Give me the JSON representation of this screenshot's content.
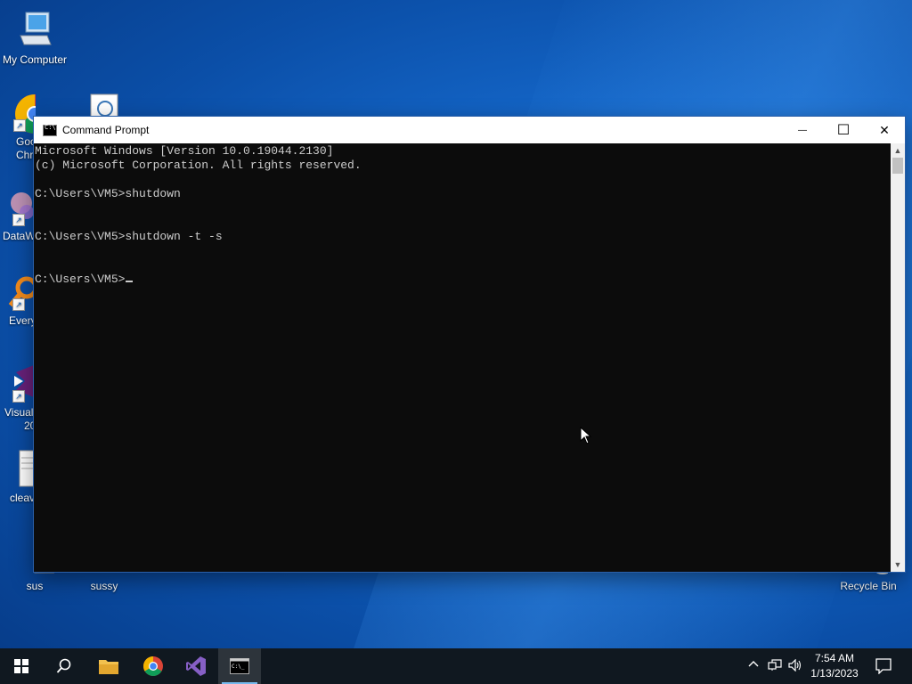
{
  "desktop": {
    "icons": {
      "my_computer": "My Computer",
      "google_chrome_1": "Goo",
      "google_chrome_2": "Chr",
      "datawrapper": "DataW",
      "everything": "Every",
      "visual_studio_1": "Visual",
      "visual_studio_2": "20",
      "cleav": "cleav",
      "sus": "sus",
      "sussy": "sussy",
      "recycle_bin": "Recycle Bin"
    }
  },
  "window": {
    "title": "Command Prompt",
    "minimize": "—",
    "maximize": "☐",
    "close": "✕",
    "console_lines": [
      "Microsoft Windows [Version 10.0.19044.2130]",
      "(c) Microsoft Corporation. All rights reserved.",
      "",
      "C:\\Users\\VM5>shutdown",
      "",
      "",
      "C:\\Users\\VM5>shutdown -t -s",
      "",
      "",
      "C:\\Users\\VM5>"
    ]
  },
  "taskbar": {
    "time": "7:54 AM",
    "date": "1/13/2023"
  },
  "colors": {
    "console_bg": "#0c0c0c",
    "console_fg": "#cccccc",
    "taskbar_bg": "#101820",
    "accent": "#76b9ed"
  }
}
